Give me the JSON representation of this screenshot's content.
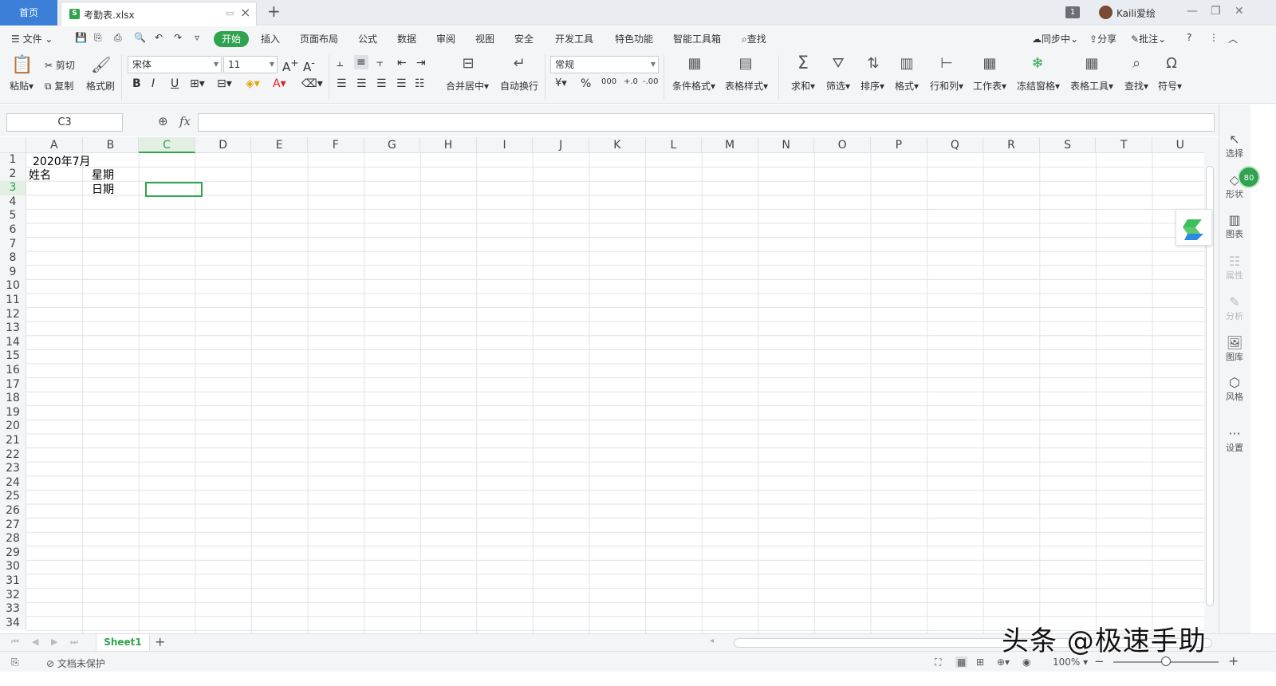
{
  "titlebar": {
    "home_tab": "首页",
    "file_icon": "S",
    "file_name": "考勤表.xlsx",
    "badge": "1",
    "user_name": "Kaili爱绘"
  },
  "menu": {
    "file": "文件",
    "items": [
      "开始",
      "插入",
      "页面布局",
      "公式",
      "数据",
      "审阅",
      "视图",
      "安全",
      "开发工具",
      "特色功能",
      "智能工具箱"
    ],
    "search": "查找",
    "sync": "同步中",
    "share": "分享",
    "comment": "批注"
  },
  "ribbon": {
    "paste": "粘贴",
    "cut": "剪切",
    "copy": "复制",
    "format_painter": "格式刷",
    "font_name": "宋体",
    "font_size": "11",
    "merge_center": "合并居中",
    "wrap_text": "自动换行",
    "number_format": "常规",
    "conditional_format": "条件格式",
    "table_style": "表格样式",
    "sum": "求和",
    "filter": "筛选",
    "sort": "排序",
    "format": "格式",
    "row_col": "行和列",
    "worksheet": "工作表",
    "freeze": "冻结窗格",
    "table_tools": "表格工具",
    "find": "查找",
    "symbol": "符号"
  },
  "formula": {
    "name_box": "C3",
    "fx": "fx",
    "content": ""
  },
  "grid": {
    "columns": [
      "A",
      "B",
      "C",
      "D",
      "E",
      "F",
      "G",
      "H",
      "I",
      "J",
      "K",
      "L",
      "M",
      "N",
      "O",
      "P",
      "Q",
      "R",
      "S",
      "T",
      "U"
    ],
    "rows": [
      "1",
      "2",
      "3",
      "4",
      "5",
      "6",
      "7",
      "8",
      "9",
      "10",
      "11",
      "12",
      "13",
      "14",
      "15",
      "16",
      "17",
      "18",
      "19",
      "20",
      "21",
      "22",
      "23",
      "24",
      "25",
      "26",
      "27",
      "28",
      "29",
      "30",
      "31",
      "32",
      "33",
      "34"
    ],
    "cells": {
      "A1": "2020年7月",
      "A2": "姓名",
      "B2": "星期",
      "B3": "日期"
    },
    "selected": "C3"
  },
  "side_panel": {
    "items": [
      "选择",
      "形状",
      "图表",
      "属性",
      "分析",
      "图库",
      "风格",
      "设置"
    ],
    "badge": "80"
  },
  "sheets": {
    "active": "Sheet1"
  },
  "status": {
    "protect": "文档未保护",
    "zoom": "100%"
  },
  "watermark": "头条 @极速手助"
}
